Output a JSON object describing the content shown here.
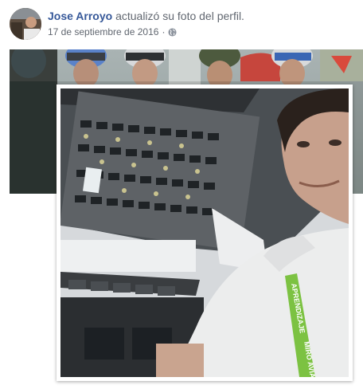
{
  "post": {
    "author": "Jose Arroyo",
    "action": "actualizó su foto del perfil.",
    "timestamp": "17 de septiembre de 2016",
    "separator": "·",
    "privacy_icon": "globe-icon"
  },
  "photo": {
    "lanyard_text": "APRENDIZAJE",
    "lanyard_text_2": "MIRO AVIA"
  },
  "colors": {
    "author_link": "#365899",
    "meta_text": "#616770",
    "lanyard": "#7cc242"
  }
}
